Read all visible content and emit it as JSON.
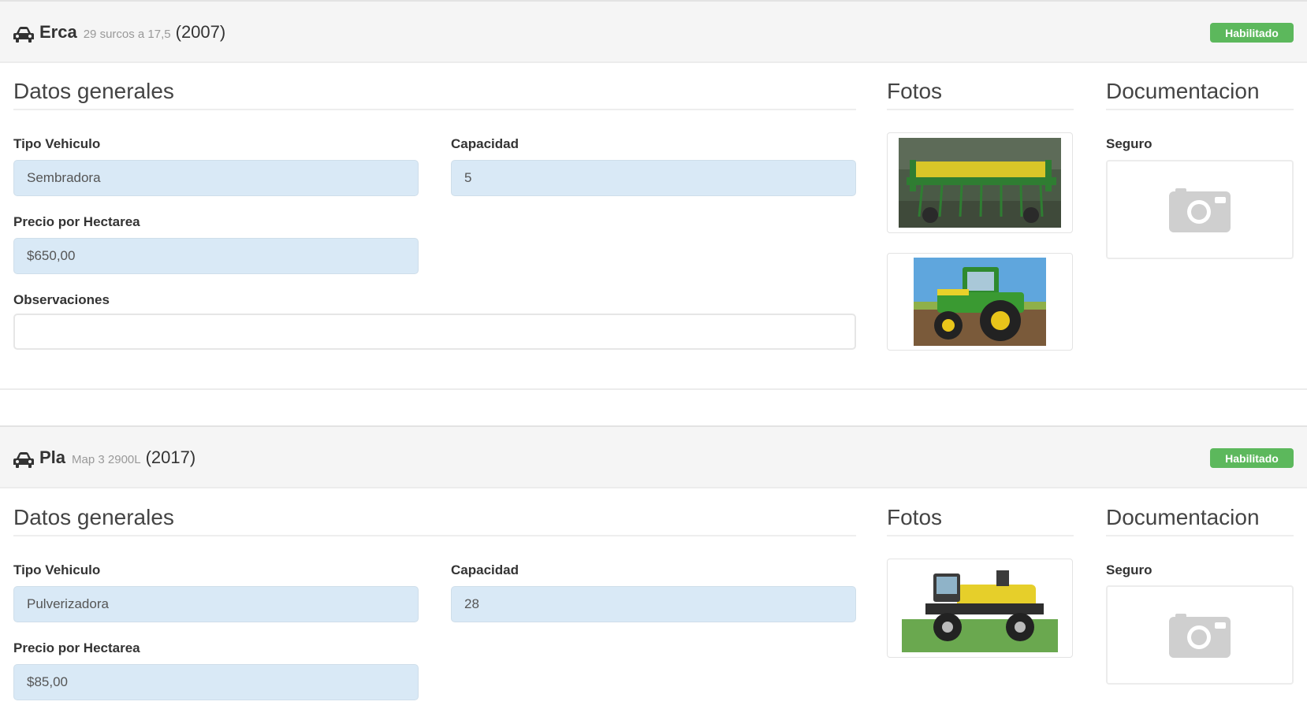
{
  "vehicles": [
    {
      "name": "Erca",
      "model": "29 surcos a 17,5",
      "year": "(2007)",
      "status": "Habilitado",
      "general_title": "Datos generales",
      "photos_title": "Fotos",
      "docs_title": "Documentacion",
      "tipo_label": "Tipo Vehiculo",
      "tipo_value": "Sembradora",
      "capacidad_label": "Capacidad",
      "capacidad_value": "5",
      "precio_label": "Precio por Hectarea",
      "precio_value": "$650,00",
      "obs_label": "Observaciones",
      "obs_value": "",
      "seguro_label": "Seguro",
      "photos": [
        "seeder-photo",
        "tractor-photo"
      ]
    },
    {
      "name": "Pla",
      "model": "Map 3 2900L",
      "year": "(2017)",
      "status": "Habilitado",
      "general_title": "Datos generales",
      "photos_title": "Fotos",
      "docs_title": "Documentacion",
      "tipo_label": "Tipo Vehiculo",
      "tipo_value": "Pulverizadora",
      "capacidad_label": "Capacidad",
      "capacidad_value": "28",
      "precio_label": "Precio por Hectarea",
      "precio_value": "$85,00",
      "seguro_label": "Seguro",
      "photos": [
        "sprayer-photo"
      ]
    }
  ],
  "colors": {
    "badge": "#5cb85c",
    "field_bg": "#d9e9f6",
    "header_bg": "#f5f5f5"
  }
}
